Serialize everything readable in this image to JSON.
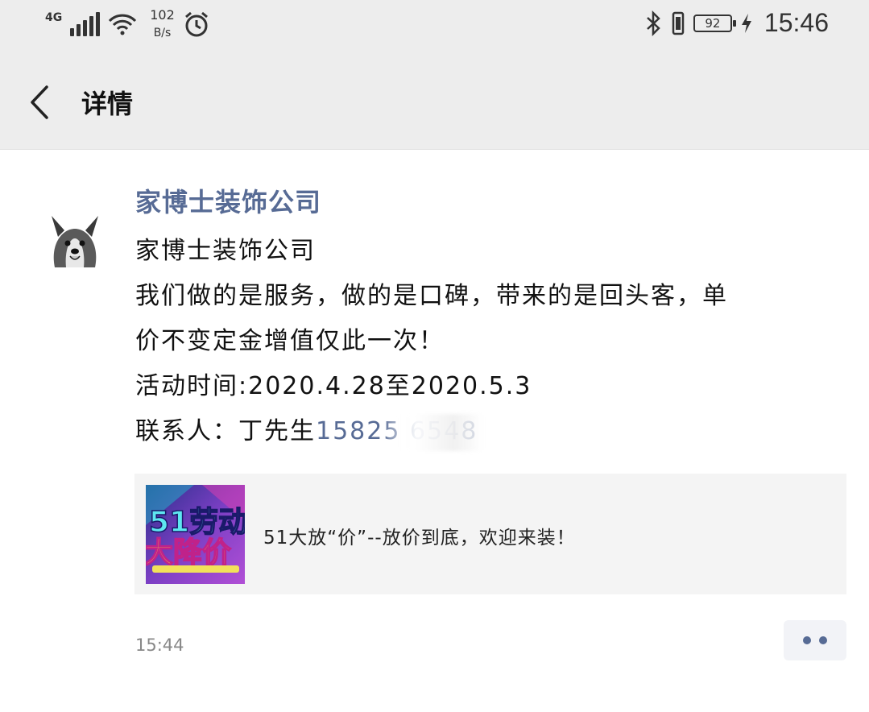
{
  "status_bar": {
    "network_type": "4G",
    "speed_value": "102",
    "speed_unit": "B/s",
    "battery_level": "92",
    "time": "15:46"
  },
  "header": {
    "title": "详情"
  },
  "post": {
    "author": "家博士装饰公司",
    "lines": [
      "家博士装饰公司",
      "我们做的是服务，做的是口碑，带来的是回头客，单",
      "价不变定金增值仅此一次！",
      "活动时间:2020.4.28至2020.5.3",
      "联系人：丁先生"
    ],
    "phone_partial": "15825",
    "phone_tail": "  6548",
    "link_card": {
      "title": "51大放“价”--放价到底，欢迎来装！",
      "thumbnail_text_top": "51劳动",
      "thumbnail_text_bottom": "大降价"
    },
    "timestamp": "15:44"
  },
  "colors": {
    "bar_bg": "#ededed",
    "link_blue": "#576b95",
    "card_bg": "#f4f4f4"
  }
}
